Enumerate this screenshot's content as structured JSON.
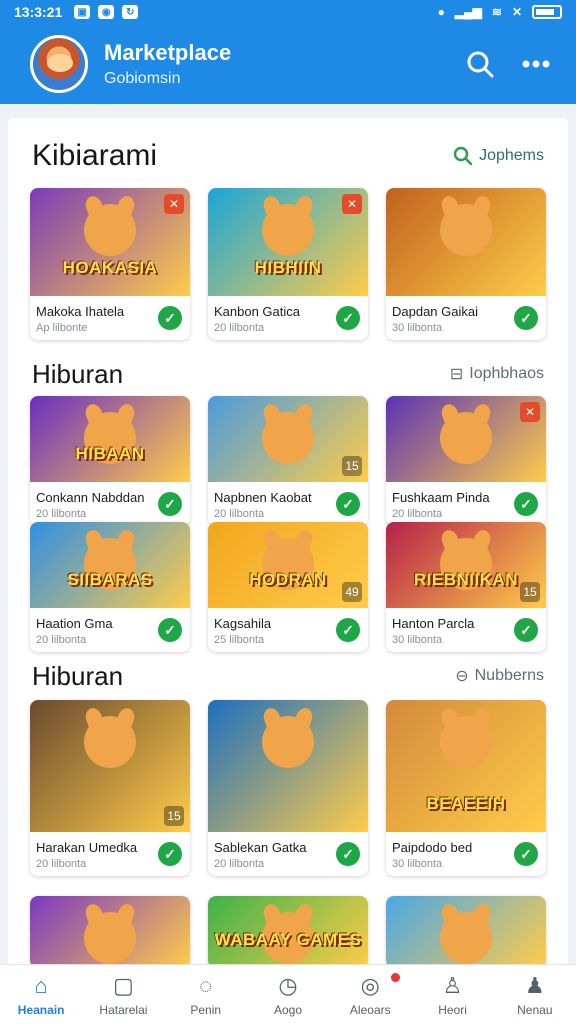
{
  "status": {
    "time": "13:3:21"
  },
  "header": {
    "title": "Marketplace",
    "subtitle": "Gobiomsin"
  },
  "sections": [
    {
      "title": "Kibiarami",
      "link": "Jophems",
      "cards": [
        {
          "name": "Makoka Ihatela",
          "sub": "Ap lilbonte",
          "art": "HOAKASIA",
          "bg": "#7a3bb8",
          "badge": "✕",
          "badge_color": "red"
        },
        {
          "name": "Kanbon Gatica",
          "sub": "20 lilbonta",
          "art": "HIBHIIN",
          "bg": "#1aa6d9",
          "badge": "✕",
          "badge_color": "red"
        },
        {
          "name": "Dapdan Gaikai",
          "sub": "30 lilbonta",
          "art": "",
          "bg": "#c0621d",
          "badge": "",
          "badge_color": ""
        }
      ]
    },
    {
      "title": "Hiburan",
      "link": "Iophbhaos",
      "cards": [
        {
          "name": "Conkann Nabddan",
          "sub": "20 lilbonta",
          "art": "HIBAAN",
          "bg": "#6a2ec2",
          "badge": "",
          "badge_color": ""
        },
        {
          "name": "Napbnen Kaobat",
          "sub": "20 lilbonta",
          "art": "",
          "bg": "#4a9be0",
          "badge": "15",
          "badge_color": ""
        },
        {
          "name": "Fushkaam Pinda",
          "sub": "20 lilbonta",
          "art": "",
          "bg": "#5a32b5",
          "badge": "✕",
          "badge_color": "red"
        },
        {
          "name": "Haation Gma",
          "sub": "20 lilbonta",
          "art": "SIIBARAS",
          "bg": "#2f8fe5",
          "badge": "",
          "badge_color": ""
        },
        {
          "name": "Kagsahila",
          "sub": "25 lilbonta",
          "art": "HODRAN",
          "bg": "#f2a61f",
          "badge": "49",
          "badge_color": ""
        },
        {
          "name": "Hanton Parcla",
          "sub": "30 lilbonta",
          "art": "RIEBNIIKAN",
          "bg": "#b5214a",
          "badge": "15",
          "badge_color": ""
        }
      ]
    },
    {
      "title": "Hiburan",
      "link": "Nubberns",
      "cards": [
        {
          "name": "Harakan Umedka",
          "sub": "20 lilbonta",
          "art": "",
          "bg": "#6a4a2f",
          "badge": "15",
          "badge_color": ""
        },
        {
          "name": "Sablekan Gatka",
          "sub": "20 lilbonta",
          "art": "",
          "bg": "#1c6fbf",
          "badge": "",
          "badge_color": ""
        },
        {
          "name": "Paipdodo bed",
          "sub": "30 lilbonta",
          "art": "BEAEEIH",
          "bg": "#d48a3a",
          "badge": "",
          "badge_color": ""
        },
        {
          "name": "",
          "sub": "",
          "art": "",
          "bg": "#7b38c2",
          "badge": "",
          "badge_color": ""
        },
        {
          "name": "",
          "sub": "",
          "art": "WABAAY GAMES",
          "bg": "#3cb34a",
          "badge": "",
          "badge_color": ""
        },
        {
          "name": "",
          "sub": "",
          "art": "",
          "bg": "#49a7e8",
          "badge": "",
          "badge_color": ""
        }
      ]
    }
  ],
  "nav": [
    {
      "label": "Heanain",
      "icon": "home-icon",
      "active": true
    },
    {
      "label": "Hatarelai",
      "icon": "square-icon",
      "active": false
    },
    {
      "label": "Penin",
      "icon": "chat-icon",
      "active": false
    },
    {
      "label": "Aogo",
      "icon": "clock-icon",
      "active": false
    },
    {
      "label": "Aleoars",
      "icon": "gamepad-icon",
      "active": false
    },
    {
      "label": "Heori",
      "icon": "person-icon",
      "active": false
    },
    {
      "label": "Nenau",
      "icon": "profile-icon",
      "active": false
    }
  ]
}
